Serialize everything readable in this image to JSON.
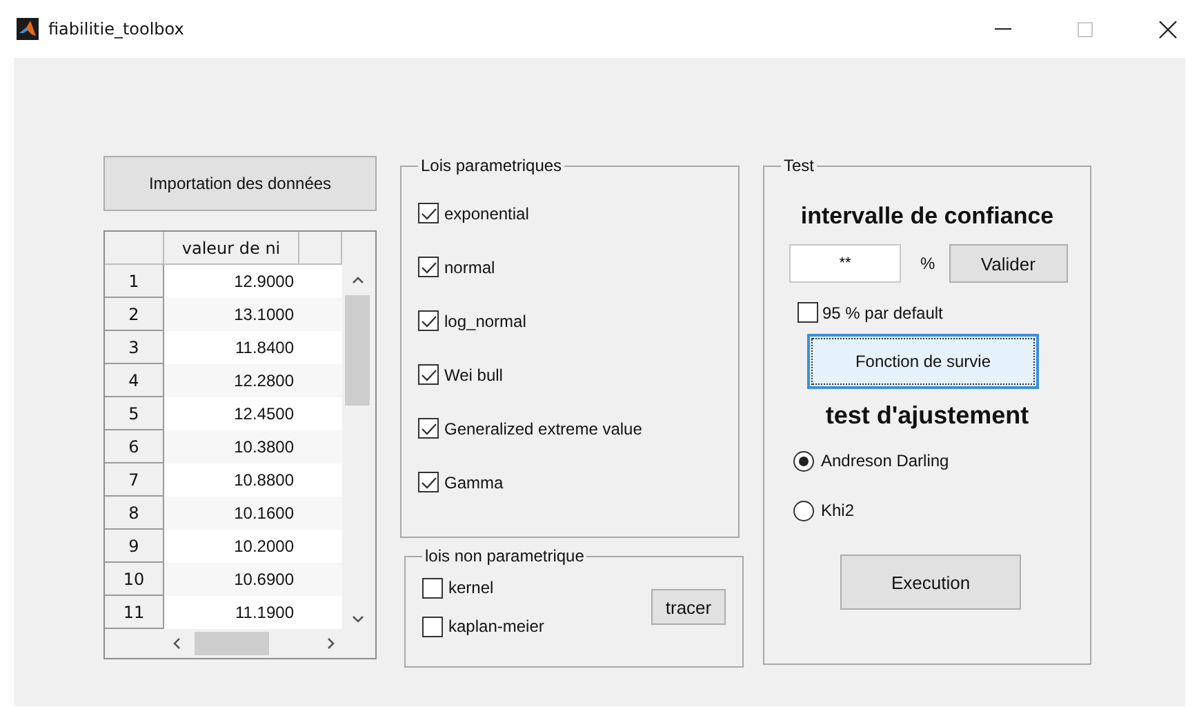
{
  "window": {
    "title": "fiabilitie_toolbox"
  },
  "import_button": "Importation des données",
  "table": {
    "columns": [
      "valeur de ni"
    ],
    "rows": [
      {
        "index": "1",
        "value": "12.9000"
      },
      {
        "index": "2",
        "value": "13.1000"
      },
      {
        "index": "3",
        "value": "11.8400"
      },
      {
        "index": "4",
        "value": "12.2800"
      },
      {
        "index": "5",
        "value": "12.4500"
      },
      {
        "index": "6",
        "value": "10.3800"
      },
      {
        "index": "7",
        "value": "10.8800"
      },
      {
        "index": "8",
        "value": "10.1600"
      },
      {
        "index": "9",
        "value": "10.2000"
      },
      {
        "index": "10",
        "value": "10.6900"
      },
      {
        "index": "11",
        "value": "11.1900"
      }
    ]
  },
  "parametric_laws": {
    "title": "Lois parametriques",
    "items": [
      {
        "label": "exponential",
        "checked": true
      },
      {
        "label": "normal",
        "checked": true
      },
      {
        "label": "log_normal",
        "checked": true
      },
      {
        "label": "Wei bull",
        "checked": true
      },
      {
        "label": "Generalized extreme value",
        "checked": true
      },
      {
        "label": "Gamma",
        "checked": true
      }
    ]
  },
  "nonparametric_laws": {
    "title": "lois non parametrique",
    "items": [
      {
        "label": "kernel",
        "checked": false
      },
      {
        "label": "kaplan-meier",
        "checked": false
      }
    ],
    "button": "tracer"
  },
  "test": {
    "title": "Test",
    "confidence_heading": "intervalle de confiance",
    "confidence_field": {
      "value": "**"
    },
    "percent_label": "%",
    "validate_button": "Valider",
    "default_checkbox": {
      "label": "95 % par default",
      "checked": false
    },
    "survival_button": {
      "label": "Fonction de survie",
      "focused": true
    },
    "fit_heading": "test d'ajustement",
    "fit_tests": [
      {
        "label": "Andreson Darling",
        "selected": true
      },
      {
        "label": "Khi2",
        "selected": false
      }
    ],
    "run_button": "Execution"
  }
}
